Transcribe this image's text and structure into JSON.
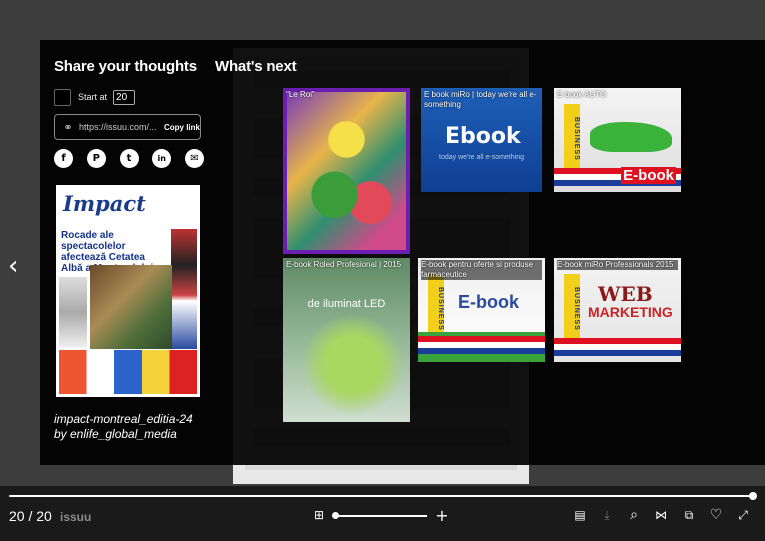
{
  "share": {
    "title": "Share your thoughts",
    "start_label": "Start at",
    "start_value": "20",
    "link_value": "https://issuu.com/...",
    "copy_label": "Copy link",
    "socials": [
      {
        "name": "facebook-icon",
        "glyph": "f"
      },
      {
        "name": "pinterest-icon",
        "glyph": "P"
      },
      {
        "name": "twitter-icon",
        "glyph": "t"
      },
      {
        "name": "linkedin-icon",
        "glyph": "in"
      },
      {
        "name": "email-icon",
        "glyph": "✉"
      }
    ]
  },
  "publication": {
    "cover_masthead": "Impact",
    "cover_headline": "Rocade ale spectacolelor afectează Cetatea Albă a Montrealului",
    "title_line1": "impact-montreal_editia-24",
    "title_line2": "by enlife_global_media"
  },
  "next": {
    "title": "What's next",
    "items": [
      {
        "label": "\"Le Roi\""
      },
      {
        "label": "E book miRo | today we're all e-something"
      },
      {
        "label": "E-book AUTO"
      },
      {
        "label": "E-book Roled Profesional | 2015"
      },
      {
        "label": "E-book pentru oferte si produse farmaceutice"
      },
      {
        "label": "E-book miRo Professionals 2015"
      }
    ],
    "thumb_texts": {
      "ebook": "Ebook",
      "ebook_sub": "today we're all e-something",
      "business": "BUSINESS",
      "us": "US",
      "ebook_red": "E-book",
      "led_line": "de iluminat LED",
      "ebook_green": "E-book",
      "web": "WEB",
      "marketing": "MARKETING"
    }
  },
  "toolbar": {
    "page_count": "20 / 20",
    "brand": "issuu",
    "progress": 1.0
  },
  "icons": {
    "prev": "‹",
    "grid": "⊞",
    "plus": "+",
    "reader": "▤",
    "download": "⤓",
    "search": "⌕",
    "share": "⋈",
    "pages": "⧉",
    "like": "♡",
    "fullscreen": "⤢"
  }
}
